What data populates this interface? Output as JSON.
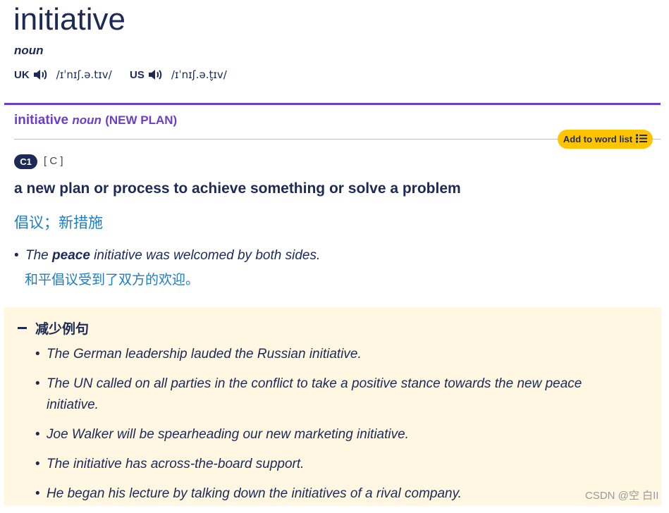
{
  "entry": {
    "headword": "initiative",
    "pos": "noun",
    "pronunciations": [
      {
        "region": "UK",
        "ipa": "/ɪˈnɪʃ.ə.tɪv/",
        "icon": "speaker-icon"
      },
      {
        "region": "US",
        "ipa": "/ɪˈnɪʃ.ə.t̬ɪv/",
        "icon": "speaker-icon"
      }
    ]
  },
  "sense": {
    "headword": "initiative",
    "pos": "noun",
    "guideword": "(NEW PLAN)",
    "add_to_word_list": "Add to word list",
    "level": "C1",
    "grammar": "[ C ]",
    "definition": "a new plan or process to achieve something or solve a problem",
    "translation": "倡议；新措施",
    "example": {
      "before": "The ",
      "bold": "peace",
      "after": " initiative was welcomed by both sides.",
      "translation": "和平倡议受到了双方的欢迎。"
    }
  },
  "more_examples": {
    "toggle_label": "减少例句",
    "items": [
      "The German leadership lauded the Russian initiative.",
      "The UN called on all parties in the conflict to take a positive stance towards the new peace initiative.",
      "Joe Walker will be spearheading our new marketing initiative.",
      "The initiative has across-the-board support.",
      "He began his lecture by talking down the initiatives of a rival company."
    ]
  },
  "watermark": "CSDN @空 白II",
  "colors": {
    "navy": "#1d2a57",
    "purple": "#6b3fc7",
    "yellow": "#fec400",
    "blue_translation": "#1e7ebf",
    "example_bg": "#fff7e1"
  }
}
